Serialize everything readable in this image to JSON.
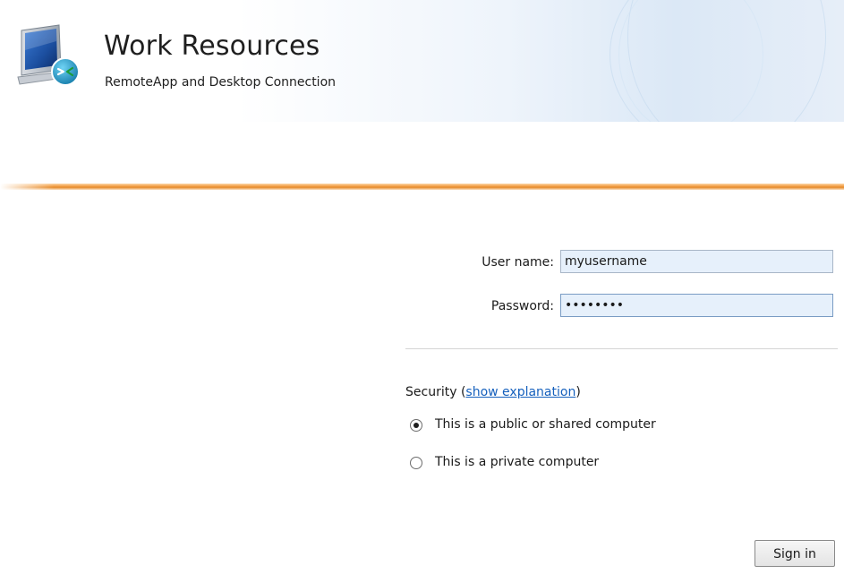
{
  "header": {
    "title": "Work Resources",
    "subtitle": "RemoteApp and Desktop Connection",
    "logo_icon": "remote-desktop-monitor-icon"
  },
  "login_form": {
    "username_label": "User name:",
    "username_value": "myusername",
    "password_label": "Password:",
    "password_value": "••••••••"
  },
  "security": {
    "label_prefix": "Security (",
    "link_text": "show explanation",
    "label_suffix": ")",
    "options": [
      {
        "label": "This is a public or shared computer",
        "selected": true
      },
      {
        "label": "This is a private computer",
        "selected": false
      }
    ]
  },
  "actions": {
    "sign_in_label": "Sign in"
  },
  "colors": {
    "accent_orange": "#e58a2a",
    "link_blue": "#1560bd",
    "input_bg": "#e6f0fb"
  }
}
